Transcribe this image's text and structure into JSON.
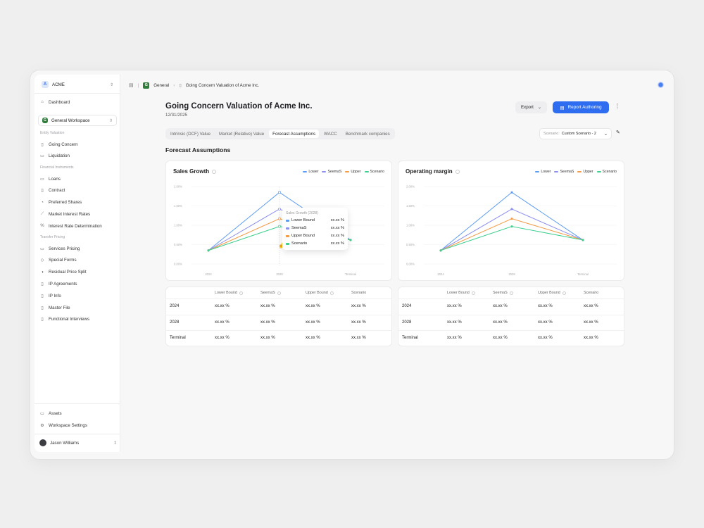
{
  "workspace_switcher": {
    "badge": "A",
    "name": "ACME"
  },
  "sidebar": {
    "dashboard": "Dashboard",
    "workspace": {
      "badge": "G",
      "name": "General Workspace"
    },
    "sections": {
      "entity_valuation": "Entity Valuation",
      "financial_instruments": "Financial Instruments",
      "transfer_pricing": "Transfer Pricing"
    },
    "entity_items": [
      {
        "label": "Going Concern",
        "icon": "document-icon"
      },
      {
        "label": "Liquidation",
        "icon": "box-icon"
      }
    ],
    "financial_items": [
      {
        "label": "Loans",
        "icon": "card-icon"
      },
      {
        "label": "Contract",
        "icon": "document-icon"
      },
      {
        "label": "Preferred Shares",
        "icon": "pie-icon"
      },
      {
        "label": "Market Interest Rates",
        "icon": "trend-icon"
      },
      {
        "label": "Interest Rate Determination",
        "icon": "percent-icon"
      }
    ],
    "transfer_items": [
      {
        "label": "Services Pricing",
        "icon": "monitor-icon"
      },
      {
        "label": "Special Forms",
        "icon": "tag-icon"
      },
      {
        "label": "Residual Price Split",
        "icon": "split-icon"
      },
      {
        "label": "IP Agreements",
        "icon": "document-icon"
      },
      {
        "label": "IP Info",
        "icon": "document-icon"
      },
      {
        "label": "Master File",
        "icon": "document-icon"
      },
      {
        "label": "Functional Interviews",
        "icon": "clipboard-icon"
      }
    ],
    "assets": "Assets",
    "workspace_settings": "Workspace Settings",
    "user": {
      "name": "Jason Williams"
    }
  },
  "breadcrumb": {
    "workspace": "General",
    "page": "Going Concern Valuation of Acme Inc."
  },
  "header": {
    "title": "Going Concern Valuation of Acme Inc.",
    "date": "12/31/2025",
    "export_label": "Export",
    "report_label": "Report Authoring"
  },
  "tabs": [
    "Intrinsic (DCF) Value",
    "Market (Relative) Value",
    "Forecast Assumptions",
    "WACC",
    "Benchmark companies"
  ],
  "active_tab": 2,
  "scenario": {
    "label": "Scenario:",
    "value": "Custom Scenario - 2"
  },
  "section_title": "Forecast Assumptions",
  "colors": {
    "lower": "#5b9bf2",
    "seemas": "#8b8ff0",
    "upper": "#f59a45",
    "scenario": "#3ecf8e",
    "accent": "#2f6df0"
  },
  "legend": [
    "Lower",
    "SeemaS",
    "Upper",
    "Scenario"
  ],
  "tooltip": {
    "title": "Sales Growth (2028)",
    "rows": [
      {
        "label": "Lower Bound",
        "value": "xx.xx %"
      },
      {
        "label": "SeemaS",
        "value": "xx.xx %"
      },
      {
        "label": "Upper Bound",
        "value": "xx.xx %"
      },
      {
        "label": "Scenario",
        "value": "xx.xx %"
      }
    ]
  },
  "chart_data": [
    {
      "type": "line",
      "title": "Sales Growth",
      "categories": [
        "2024",
        "2028",
        "Terminal"
      ],
      "yticks": [
        "2.00%",
        "1.50%",
        "1.00%",
        "0.50%",
        "0.00%"
      ],
      "ylim": [
        0,
        2.0
      ],
      "series": [
        {
          "name": "Lower",
          "values": [
            0.35,
            1.85,
            0.62
          ]
        },
        {
          "name": "SeemaS",
          "values": [
            0.35,
            1.42,
            0.62
          ]
        },
        {
          "name": "Upper",
          "values": [
            0.35,
            1.17,
            0.62
          ]
        },
        {
          "name": "Scenario",
          "values": [
            0.35,
            0.97,
            0.62
          ]
        }
      ]
    },
    {
      "type": "line",
      "title": "Operating margin",
      "categories": [
        "2024",
        "2028",
        "Terminal"
      ],
      "yticks": [
        "2.00%",
        "1.50%",
        "1.00%",
        "0.50%",
        "0.00%"
      ],
      "ylim": [
        0,
        2.0
      ],
      "series": [
        {
          "name": "Lower",
          "values": [
            0.35,
            1.85,
            0.62
          ]
        },
        {
          "name": "SeemaS",
          "values": [
            0.35,
            1.42,
            0.62
          ]
        },
        {
          "name": "Upper",
          "values": [
            0.35,
            1.17,
            0.62
          ]
        },
        {
          "name": "Scenario",
          "values": [
            0.35,
            0.97,
            0.62
          ]
        }
      ]
    }
  ],
  "tables": [
    {
      "headers": [
        "Lower Bound",
        "SeemaS",
        "Upper Bound",
        "Scenario"
      ],
      "rows": [
        {
          "label": "2024",
          "values": [
            "xx.xx %",
            "xx.xx %",
            "xx.xx %",
            "xx.xx %"
          ]
        },
        {
          "label": "2028",
          "values": [
            "xx.xx %",
            "xx.xx %",
            "xx.xx %",
            "xx.xx %"
          ]
        },
        {
          "label": "Terminal",
          "values": [
            "xx.xx %",
            "xx.xx %",
            "xx.xx %",
            "xx.xx %"
          ]
        }
      ]
    },
    {
      "headers": [
        "Lower Bound",
        "SeemaS",
        "Upper Bound",
        "Scenario"
      ],
      "rows": [
        {
          "label": "2024",
          "values": [
            "xx.xx %",
            "xx.xx %",
            "xx.xx %",
            "xx.xx %"
          ]
        },
        {
          "label": "2028",
          "values": [
            "xx.xx %",
            "xx.xx %",
            "xx.xx %",
            "xx.xx %"
          ]
        },
        {
          "label": "Terminal",
          "values": [
            "xx.xx %",
            "xx.xx %",
            "xx.xx %",
            "xx.xx %"
          ]
        }
      ]
    }
  ]
}
